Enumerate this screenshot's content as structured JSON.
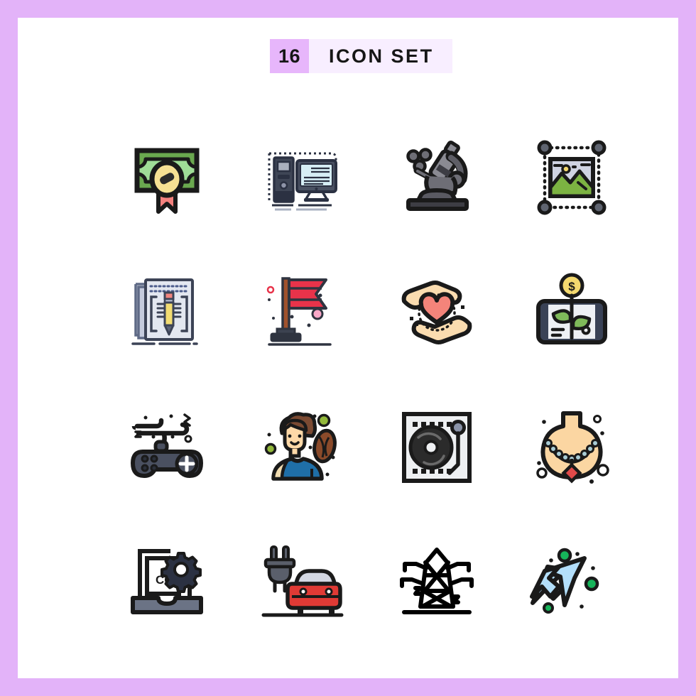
{
  "page": {
    "background_color": "#e3b3f9",
    "canvas_color": "#ffffff"
  },
  "header": {
    "count": "16",
    "title": "ICON SET",
    "count_bg": "#e7b6fb",
    "title_bg": "#f8eeff",
    "text_color": "#161616"
  },
  "grid": {
    "columns": 4,
    "rows": 4,
    "total": 16
  },
  "icons": [
    {
      "id": "money-ribbon",
      "name": "money-badge-icon",
      "label": "Money Award",
      "row": 1,
      "col": 1,
      "colors": [
        "#6aa84f",
        "#8fd18a",
        "#f7e08a",
        "#f07c7c",
        "#1a1a1a"
      ]
    },
    {
      "id": "computer",
      "name": "desktop-computer-icon",
      "label": "Computer",
      "row": 1,
      "col": 2,
      "colors": [
        "#3a4256",
        "#2b3144",
        "#d9f0f5",
        "#8e94a8",
        "#1a1a1a"
      ]
    },
    {
      "id": "microscope",
      "name": "microscope-icon",
      "label": "Microscope",
      "row": 1,
      "col": 3,
      "colors": [
        "#6b6b72",
        "#8a8a92",
        "#4a4a52",
        "#2e2e33",
        "#1a1a1a"
      ]
    },
    {
      "id": "image-select",
      "name": "image-selection-icon",
      "label": "Image",
      "row": 1,
      "col": 4,
      "colors": [
        "#7cb342",
        "#cfd3e2",
        "#f2d66b",
        "#5f6470",
        "#1a1a1a"
      ]
    },
    {
      "id": "copywriting",
      "name": "document-pencil-icon",
      "label": "Copywriting",
      "row": 2,
      "col": 1,
      "colors": [
        "#c9cfe0",
        "#e8ebf2",
        "#f2d878",
        "#f08a8a",
        "#1a1a1a"
      ]
    },
    {
      "id": "flag",
      "name": "flag-icon",
      "label": "Flag",
      "row": 2,
      "col": 2,
      "colors": [
        "#e8334a",
        "#c6243c",
        "#a0522d",
        "#2f3440",
        "#f9a8c8"
      ]
    },
    {
      "id": "care-heart",
      "name": "hands-heart-icon",
      "label": "Care",
      "row": 2,
      "col": 3,
      "colors": [
        "#fadcb0",
        "#f4846f",
        "#1a1a1a"
      ]
    },
    {
      "id": "money-plant",
      "name": "tablet-money-plant-icon",
      "label": "Money Plant",
      "row": 2,
      "col": 4,
      "colors": [
        "#3a4256",
        "#eef0f4",
        "#7fba5a",
        "#f2d06b",
        "#1a1a1a"
      ]
    },
    {
      "id": "gamepad",
      "name": "gamepad-icon",
      "label": "Game Controller",
      "row": 3,
      "col": 1,
      "colors": [
        "#4a5060",
        "#3a4050",
        "#ffffff",
        "#1a1a1a"
      ]
    },
    {
      "id": "person-ball",
      "name": "person-football-icon",
      "label": "Player",
      "row": 3,
      "col": 2,
      "colors": [
        "#7b4a32",
        "#ffd9a8",
        "#1f6fa8",
        "#8a4a2a",
        "#92b83a"
      ]
    },
    {
      "id": "turntable",
      "name": "turntable-icon",
      "label": "Turntable",
      "row": 3,
      "col": 3,
      "colors": [
        "#eef0f2",
        "#2b2b2b",
        "#8a93a8",
        "#1a1a1a"
      ]
    },
    {
      "id": "necklace",
      "name": "necklace-icon",
      "label": "Necklace",
      "row": 3,
      "col": 4,
      "colors": [
        "#fbd6a2",
        "#a8cbd4",
        "#e04a4a",
        "#1a1a1a"
      ]
    },
    {
      "id": "code-laptop",
      "name": "laptop-code-gear-icon",
      "label": "CODE",
      "row": 4,
      "col": 1,
      "colors": [
        "#6b7385",
        "#2b3142",
        "#1a1a1a"
      ]
    },
    {
      "id": "electric-car",
      "name": "electric-car-icon",
      "label": "Electric Car",
      "row": 4,
      "col": 2,
      "colors": [
        "#e03a35",
        "#c42e2a",
        "#d3d7e2",
        "#5a5f6b",
        "#1a1a1a"
      ]
    },
    {
      "id": "power-tower",
      "name": "power-tower-icon",
      "label": "Power Tower",
      "row": 4,
      "col": 3,
      "colors": [
        "#000000"
      ]
    },
    {
      "id": "cursor",
      "name": "cursor-arrow-icon",
      "label": "Cursor",
      "row": 4,
      "col": 4,
      "colors": [
        "#b3dffb",
        "#16b45a",
        "#1a1a1a"
      ]
    }
  ],
  "labels": {
    "code_text": "CODE",
    "dollar_sign": "$"
  }
}
